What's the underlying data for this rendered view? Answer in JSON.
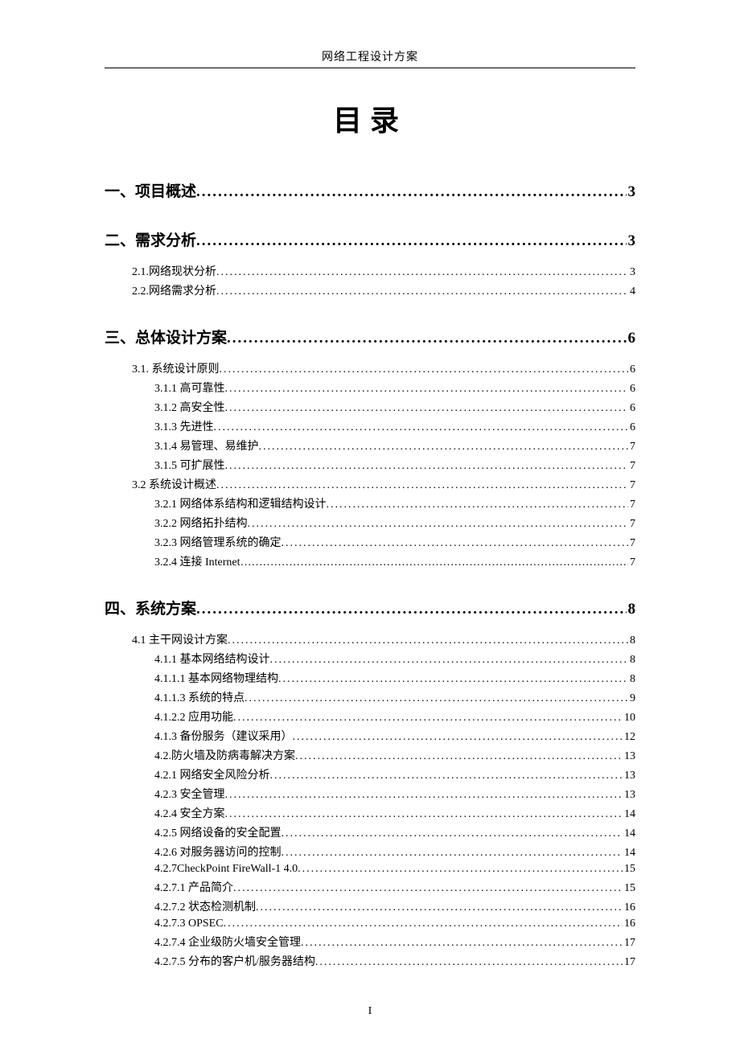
{
  "header": "网络工程设计方案",
  "title": "目录",
  "footer": "I",
  "sections": [
    {
      "label": "一、项目概述",
      "page": "3",
      "leader": "dots",
      "level": 1,
      "items": []
    },
    {
      "label": "二、需求分析",
      "page": "3",
      "leader": "dots",
      "level": 1,
      "items": [
        {
          "label": "2.1.网络现状分析",
          "page": "3",
          "level": 2,
          "leader": "dots"
        },
        {
          "label": "2.2.网络需求分析",
          "page": "4",
          "level": 2,
          "leader": "dots"
        }
      ]
    },
    {
      "label": "三、总体设计方案",
      "page": "6",
      "leader": "dots",
      "level": 1,
      "items": [
        {
          "label": "3.1.  系统设计原则",
          "page": "6",
          "level": 2,
          "leader": "dots"
        },
        {
          "label": "3.1.1  高可靠性",
          "page": "6",
          "level": 3,
          "leader": "dots"
        },
        {
          "label": "3.1.2  高安全性",
          "page": "6",
          "level": 3,
          "leader": "dots"
        },
        {
          "label": "3.1.3  先进性",
          "page": "6",
          "level": 3,
          "leader": "dots"
        },
        {
          "label": "3.1.4  易管理、易维护",
          "page": "7",
          "level": 3,
          "leader": "dots"
        },
        {
          "label": "3.1.5  可扩展性",
          "page": "7",
          "level": 3,
          "leader": "dots"
        },
        {
          "label": "3.2 系统设计概述",
          "page": "7",
          "level": 2,
          "leader": "dots"
        },
        {
          "label": "3.2.1 网络体系结构和逻辑结构设计",
          "page": "7",
          "level": 3,
          "leader": "dots"
        },
        {
          "label": "3.2.2 网络拓扑结构",
          "page": "7",
          "level": 3,
          "leader": "dots"
        },
        {
          "label": "3.2.3 网络管理系统的确定",
          "page": "7",
          "level": 3,
          "leader": "dots"
        },
        {
          "label": "3.2.4 连接 Internet",
          "page": "7",
          "level": 3,
          "leader": "ellipsis"
        }
      ]
    },
    {
      "label": "四、系统方案",
      "page": "8",
      "leader": "dots",
      "level": 1,
      "items": [
        {
          "label": "4.1 主干网设计方案",
          "page": "8",
          "level": 2,
          "leader": "dots"
        },
        {
          "label": "4.1.1 基本网络结构设计",
          "page": "8",
          "level": 3,
          "leader": "dots"
        },
        {
          "label": "4.1.1.1 基本网络物理结构",
          "page": "8",
          "level": 3,
          "leader": "dots"
        },
        {
          "label": "4.1.1.3 系统的特点",
          "page": "9",
          "level": 3,
          "leader": "dots"
        },
        {
          "label": "4.1.2.2 应用功能",
          "page": "10",
          "level": 3,
          "leader": "dots"
        },
        {
          "label": "4.1.3 备份服务（建议采用）",
          "page": "12",
          "level": 3,
          "leader": "dots"
        },
        {
          "label": "4.2.防火墙及防病毒解决方案",
          "page": "13",
          "level": 3,
          "leader": "dots"
        },
        {
          "label": "4.2.1 网络安全风险分析",
          "page": "13",
          "level": 3,
          "leader": "dots"
        },
        {
          "label": "4.2.3 安全管理",
          "page": "13",
          "level": 3,
          "leader": "dots"
        },
        {
          "label": "4.2.4 安全方案",
          "page": "14",
          "level": 3,
          "leader": "dots"
        },
        {
          "label": "4.2.5 网络设备的安全配置",
          "page": "14",
          "level": 3,
          "leader": "dots"
        },
        {
          "label": "4.2.6 对服务器访问的控制",
          "page": "14",
          "level": 3,
          "leader": "dots"
        },
        {
          "label": "4.2.7CheckPoint FireWall-1 4.0",
          "page": "15",
          "level": 3,
          "leader": "dots"
        },
        {
          "label": "4.2.7.1 产品简介",
          "page": "15",
          "level": 3,
          "leader": "dots"
        },
        {
          "label": "4.2.7.2 状态检测机制",
          "page": "16",
          "level": 3,
          "leader": "dots"
        },
        {
          "label": "4.2.7.3 OPSEC",
          "page": "16",
          "level": 3,
          "leader": "dots"
        },
        {
          "label": "4.2.7.4 企业级防火墙安全管理",
          "page": "17",
          "level": 3,
          "leader": "dots"
        },
        {
          "label": "4.2.7.5 分布的客户机/服务器结构",
          "page": "17",
          "level": 3,
          "leader": "dots"
        }
      ]
    }
  ]
}
